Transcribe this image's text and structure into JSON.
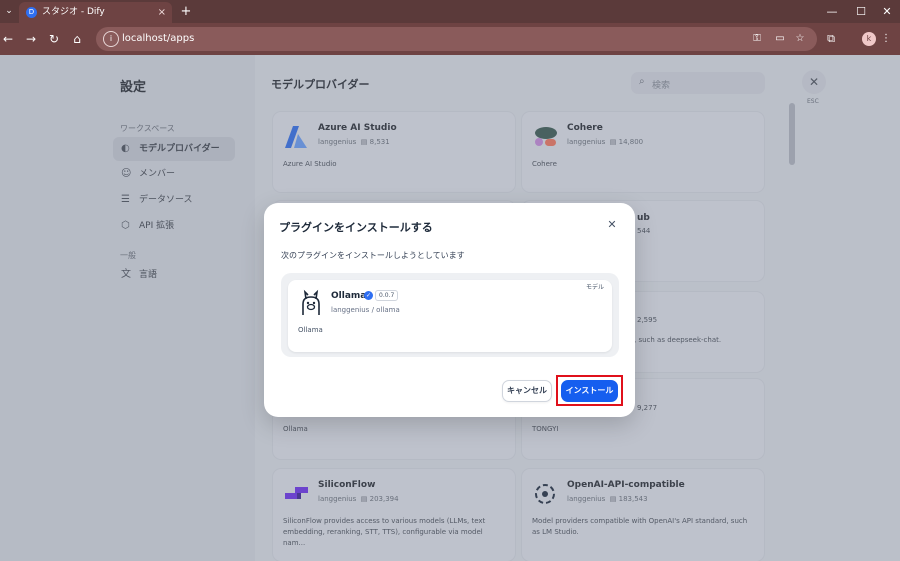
{
  "browser": {
    "tab_title": "スタジオ - Dify",
    "tab_favicon": "D",
    "tab_close": "×",
    "new_tab": "+",
    "url": "localhost/apps",
    "profile_initial": "k"
  },
  "sidebar": {
    "title": "設定",
    "workspace_group": "ワークスペース",
    "items": [
      {
        "label": "モデルプロバイダー",
        "icon": "brain-icon"
      },
      {
        "label": "メンバー",
        "icon": "members-icon"
      },
      {
        "label": "データソース",
        "icon": "database-icon"
      },
      {
        "label": "API 拡張",
        "icon": "api-icon"
      }
    ],
    "general_group": "一般",
    "general_items": [
      {
        "label": "言語",
        "icon": "language-icon"
      }
    ]
  },
  "main": {
    "title": "モデルプロバイダー",
    "search_placeholder": "検索",
    "close_hint": "ESC"
  },
  "cards": [
    {
      "name": "Azure AI Studio",
      "org": "langgenius",
      "installs": "8,531",
      "desc": "Azure AI Studio"
    },
    {
      "name": "Cohere",
      "org": "langgenius",
      "installs": "14,800",
      "desc": "Cohere"
    },
    {
      "name": "SiliconFlow",
      "org": "langgenius",
      "installs": "203,394",
      "desc": "SiliconFlow provides access to various models (LLMs, text embedding, reranking, STT, TTS), configurable via model nam..."
    },
    {
      "name": "OpenAI-API-compatible",
      "org": "langgenius",
      "installs": "183,543",
      "desc": "Model providers compatible with OpenAI's API standard, such as LM Studio."
    }
  ],
  "partial": {
    "ub": "ub",
    "n544": "544",
    "n2595": "2,595",
    "deepseek": ", such as deepseek-chat.",
    "n9277": "9,277",
    "ollama": "Ollama",
    "tongyi": "TONGYI"
  },
  "modal": {
    "title": "プラグインをインストールする",
    "description": "次のプラグインをインストールしようとしています",
    "plugin": {
      "tag": "モデル",
      "name": "Ollama",
      "version": "0.0.7",
      "org": "langgenius",
      "separator": "/",
      "package": "ollama",
      "description": "Ollama"
    },
    "cancel_label": "キャンセル",
    "install_label": "インストール"
  },
  "colors": {
    "primary": "#155eef",
    "highlight": "#e0101b",
    "browser_frame": "#6e4343"
  }
}
